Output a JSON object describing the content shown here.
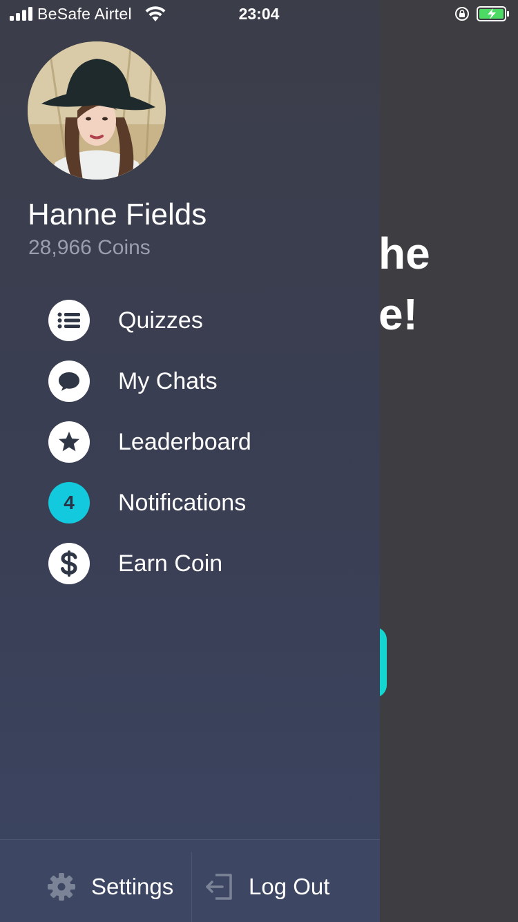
{
  "status_bar": {
    "carrier": "BeSafe Airtel",
    "time": "23:04"
  },
  "background_page": {
    "heading_line1": "he",
    "heading_line2": "e!",
    "accent_color": "#12d6cf"
  },
  "profile": {
    "name": "Hanne Fields",
    "coins": "28,966 Coins"
  },
  "menu": {
    "items": [
      {
        "label": "Quizzes",
        "icon": "list-icon"
      },
      {
        "label": "My Chats",
        "icon": "chat-bubble-icon"
      },
      {
        "label": "Leaderboard",
        "icon": "star-icon"
      },
      {
        "label": "Notifications",
        "icon": "notification-badge",
        "badge": "4"
      },
      {
        "label": "Earn Coin",
        "icon": "dollar-icon"
      }
    ]
  },
  "footer": {
    "settings_label": "Settings",
    "logout_label": "Log Out"
  },
  "colors": {
    "drawer_top": "#3b3d49",
    "drawer_bottom": "#3b4562",
    "badge": "#12c9dd",
    "battery": "#4cd964"
  }
}
